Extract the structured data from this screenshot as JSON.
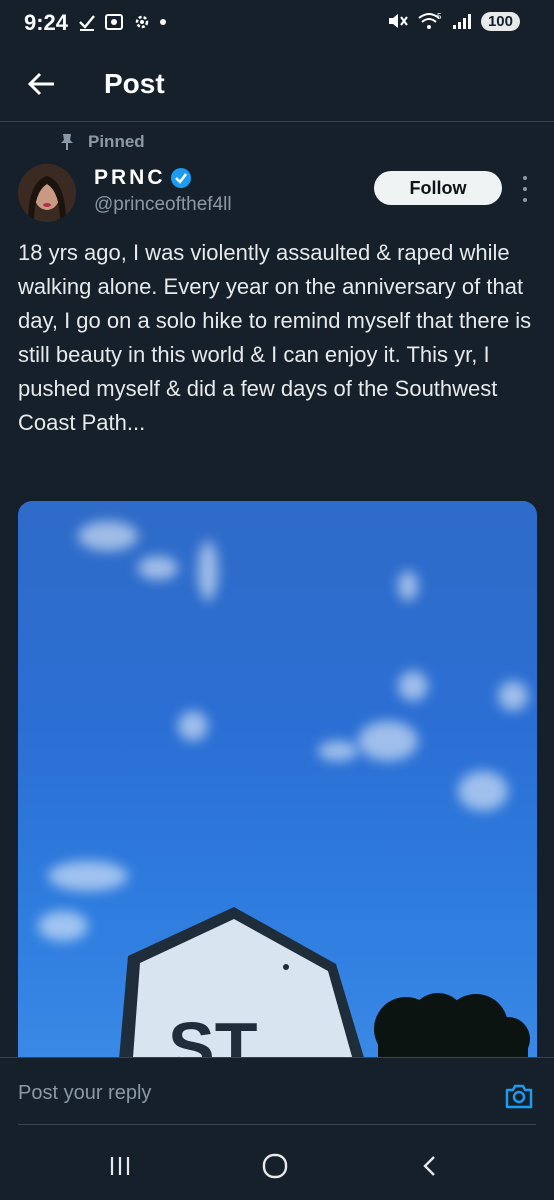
{
  "status_bar": {
    "time": "9:24",
    "battery": "100"
  },
  "header": {
    "title": "Post"
  },
  "post": {
    "pinned_label": "Pinned",
    "author": {
      "display_name": "PRNC",
      "handle": "@princeofthef4ll",
      "verified": true
    },
    "follow_label": "Follow",
    "text": "18 yrs ago, I was violently assaulted & raped while walking alone. Every year on the anniversary of that day, I go on a solo hike to remind myself that there is still beauty in this world & I can enjoy it. This yr, I pushed myself & did a few days of the Southwest Coast Path...",
    "media": {
      "sign_text": "ST"
    }
  },
  "reply": {
    "placeholder": "Post your reply"
  },
  "colors": {
    "background": "#15202b",
    "accent": "#1d9bf0",
    "muted": "#8b98a5"
  },
  "icons": [
    "back-arrow-icon",
    "pin-icon",
    "verified-badge-icon",
    "more-options-icon",
    "camera-icon",
    "recent-apps-icon",
    "home-icon",
    "back-icon"
  ]
}
